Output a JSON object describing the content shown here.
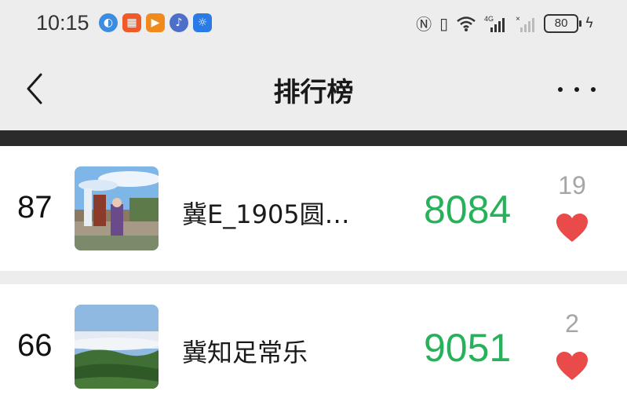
{
  "status_bar": {
    "time": "10:15",
    "battery": "80",
    "notification_icons": [
      {
        "name": "app-icon-blue",
        "color": "#3a8de0"
      },
      {
        "name": "app-icon-orange",
        "color": "#f05a28"
      },
      {
        "name": "video-icon",
        "color": "#f08a1c"
      },
      {
        "name": "music-icon",
        "color": "#4e6fc9"
      },
      {
        "name": "bulb-icon",
        "color": "#2b7be5"
      }
    ]
  },
  "nav": {
    "title": "排行榜"
  },
  "colors": {
    "steps_green": "#26b15a",
    "heart_red": "#e94b4b",
    "background": "#ededed"
  },
  "ranking": [
    {
      "rank": "87",
      "name": "冀E_1905圆…",
      "steps": "8084",
      "likes": "19"
    },
    {
      "rank": "66",
      "name": "冀知足常乐",
      "steps": "9051",
      "likes": "2"
    }
  ]
}
